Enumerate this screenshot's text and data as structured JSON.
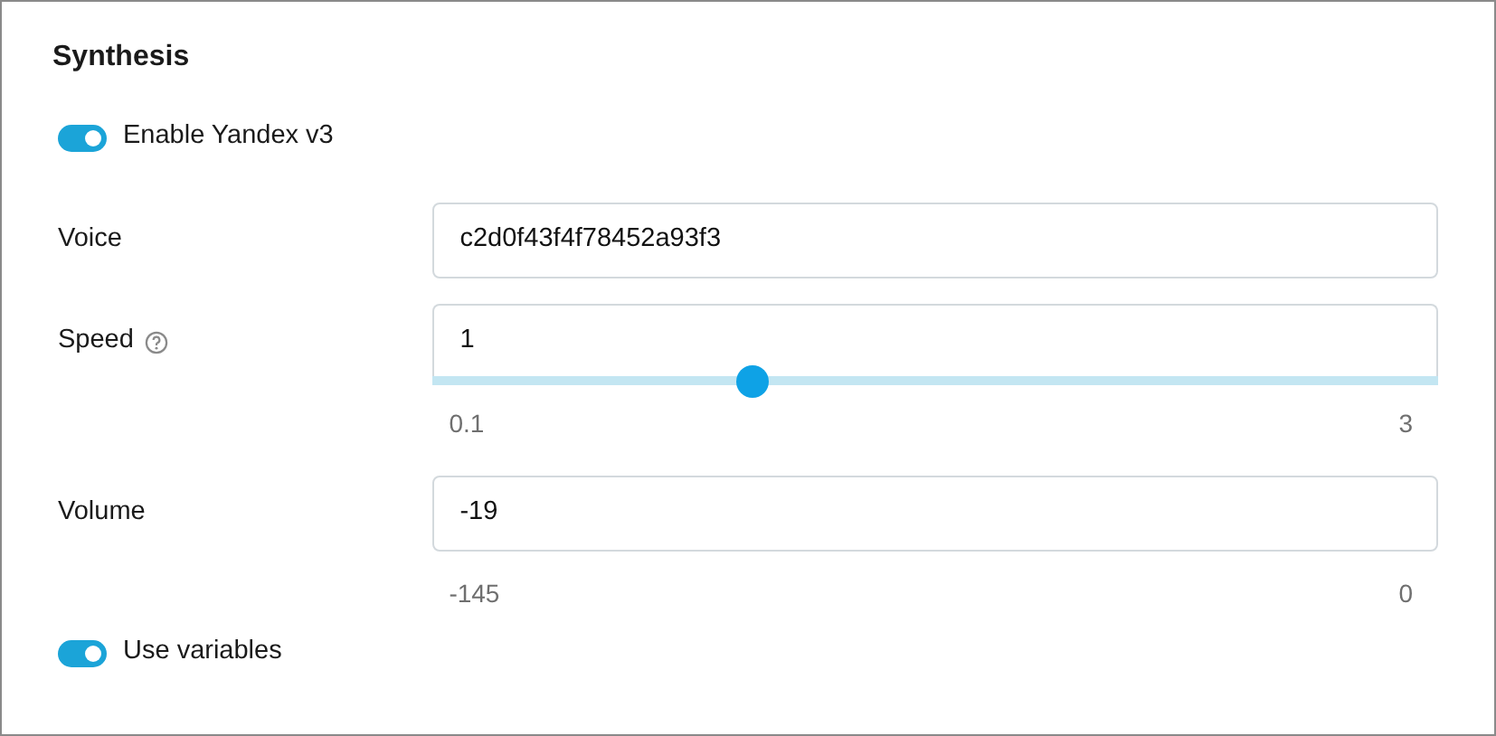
{
  "section": {
    "title": "Synthesis"
  },
  "fields": [
    {
      "kind": "toggle",
      "label": "Enable Yandex v3",
      "on": true
    },
    {
      "kind": "text",
      "label": "Voice",
      "value": "c2d0f43f4f78452a93f3"
    },
    {
      "kind": "slider",
      "label": "Speed",
      "help": true,
      "value": "1",
      "level": 0.318,
      "min": "0.1",
      "max": "3"
    },
    {
      "kind": "range",
      "label": "Volume",
      "value": "-19",
      "min": "-145",
      "max": "0"
    },
    {
      "kind": "toggle",
      "label": "Use variables",
      "on": true
    }
  ]
}
